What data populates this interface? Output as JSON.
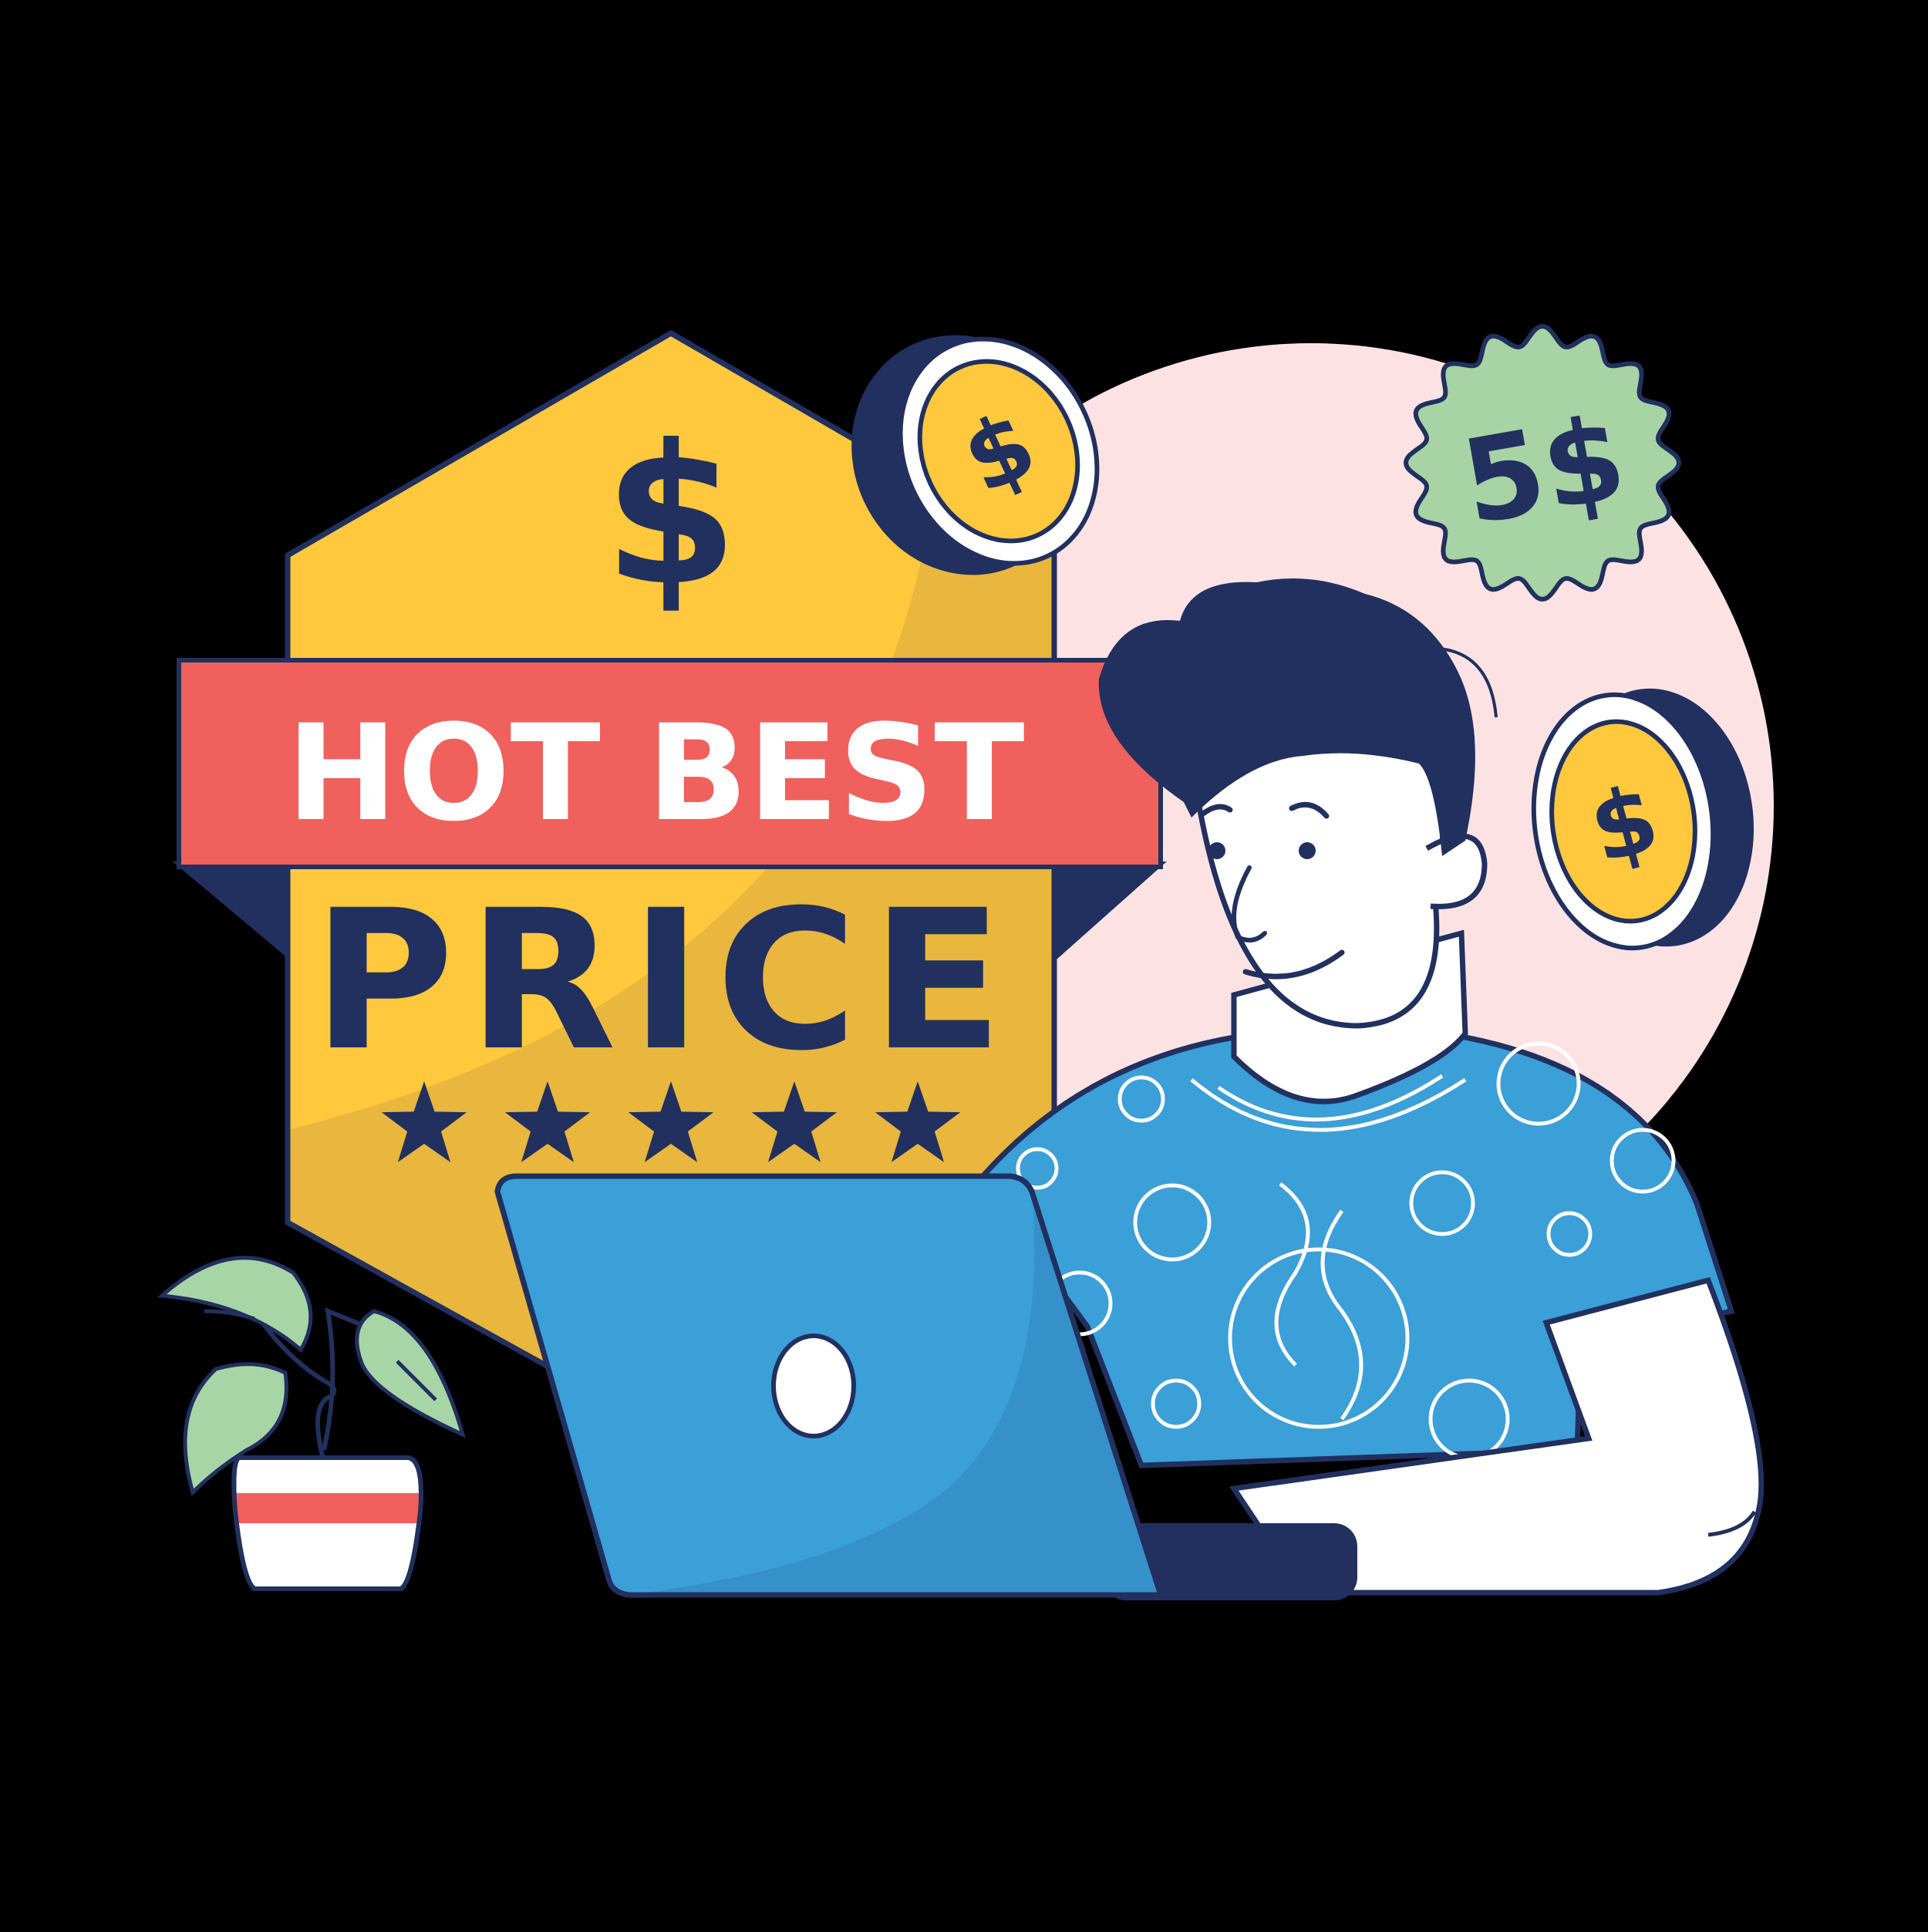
{
  "badge": {
    "currency_symbol": "$",
    "ribbon_text": "HOT BEST",
    "headline": "PRICE",
    "rating_stars": 5
  },
  "price_sticker": {
    "text": "5$"
  },
  "coins": [
    {
      "symbol": "$"
    },
    {
      "symbol": "$"
    }
  ],
  "colors": {
    "background": "#000000",
    "badge_yellow": "#FFC83D",
    "badge_shade": "#E9B63E",
    "ribbon_red": "#F0605D",
    "navy": "#21305F",
    "sky_blue": "#3B9FD8",
    "pink_circle": "#FDE2E4",
    "sticker_green": "#A7D3A5",
    "leaf_green": "#A8D5A6",
    "white": "#FFFFFF"
  },
  "icons": [
    "dollar-coin-icon",
    "dollar-coin-icon",
    "star-icon",
    "laptop-icon",
    "plant-icon"
  ]
}
